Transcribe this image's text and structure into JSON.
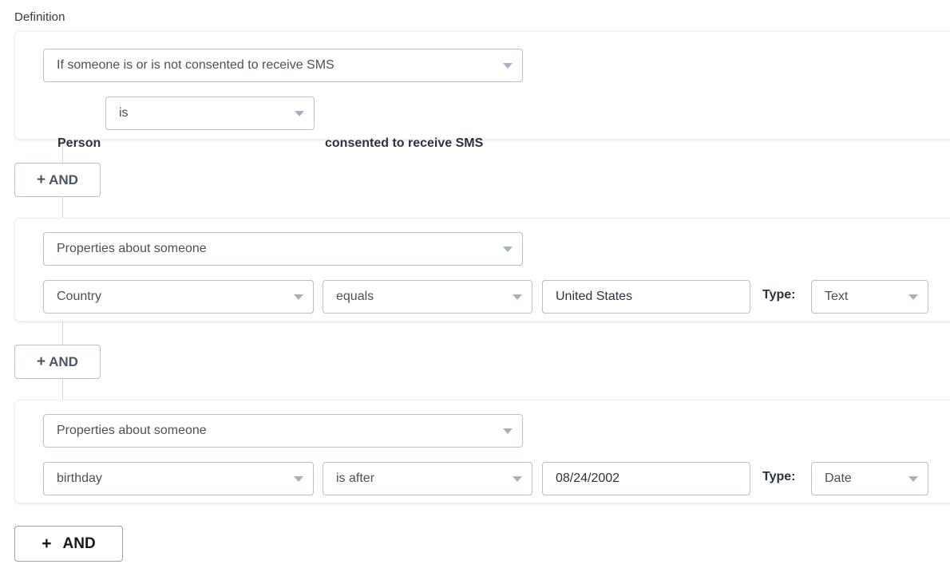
{
  "section": {
    "title": "Definition"
  },
  "conditions": [
    {
      "trigger": "If someone is or is not consented to receive SMS",
      "subject_label": "Person",
      "operator": "is",
      "suffix_text": "consented to receive SMS"
    },
    {
      "trigger": "Properties about someone",
      "field": "Country",
      "operator": "equals",
      "value": "United States",
      "type_label": "Type:",
      "type_value": "Text"
    },
    {
      "trigger": "Properties about someone",
      "field": "birthday",
      "operator": "is after",
      "value": "08/24/2002",
      "type_label": "Type:",
      "type_value": "Date"
    }
  ],
  "buttons": {
    "and_inline_1": {
      "plus": "+",
      "label": "AND"
    },
    "and_inline_2": {
      "plus": "+",
      "label": "AND"
    },
    "and_add": {
      "plus": "+",
      "label": "AND"
    }
  },
  "icons": {
    "caret": "chevron-down-icon"
  },
  "colors": {
    "text_primary": "#2b3340",
    "text_secondary": "#4a515b",
    "border": "#b8bfc9",
    "caret": "#a7b0bd",
    "card_shadow": "rgba(30,40,60,0.10)"
  }
}
